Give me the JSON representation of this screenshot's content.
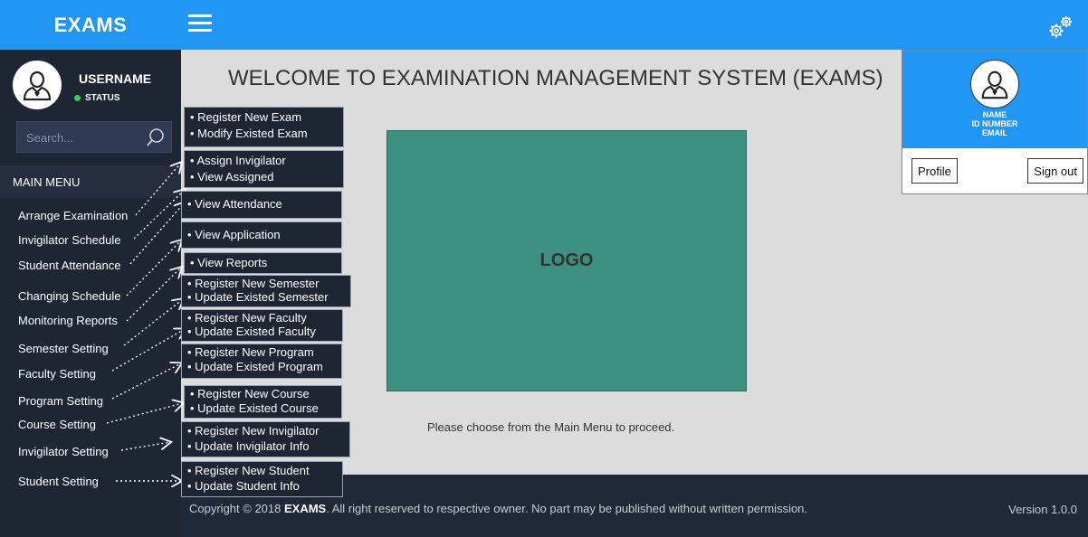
{
  "header": {
    "brand": "EXAMS"
  },
  "user": {
    "username": "USERNAME",
    "status": "STATUS"
  },
  "search": {
    "placeholder": "Search..."
  },
  "sidebar": {
    "main_menu_label": "MAIN MENU",
    "items": [
      {
        "label": "Arrange Examination"
      },
      {
        "label": "Invigilator Schedule"
      },
      {
        "label": "Student Attendance"
      },
      {
        "label": "Changing Schedule"
      },
      {
        "label": "Monitoring Reports"
      },
      {
        "label": "Semester Setting"
      },
      {
        "label": "Faculty Setting"
      },
      {
        "label": "Program Setting"
      },
      {
        "label": "Course Setting"
      },
      {
        "label": "Invigilator Setting"
      },
      {
        "label": "Student Setting"
      }
    ]
  },
  "submenus": [
    {
      "options": [
        "Register New Exam",
        "Modify Existed Exam"
      ]
    },
    {
      "options": [
        "Assign Invigilator",
        "View Assigned"
      ]
    },
    {
      "options": [
        "View Attendance"
      ]
    },
    {
      "options": [
        "View Application"
      ]
    },
    {
      "options": [
        "View Reports"
      ]
    },
    {
      "options": [
        "Register New Semester",
        "Update Existed Semester"
      ]
    },
    {
      "options": [
        "Register New Faculty",
        "Update Existed Faculty"
      ]
    },
    {
      "options": [
        "Register New Program",
        "Update Existed Program"
      ]
    },
    {
      "options": [
        "Register New Course",
        "Update Existed Course"
      ]
    },
    {
      "options": [
        "Register New Invigilator",
        "Update Invigilator Info"
      ]
    },
    {
      "options": [
        "Register New Student",
        "Update Student Info"
      ]
    }
  ],
  "main": {
    "welcome": "WELCOME TO EXAMINATION MANAGEMENT SYSTEM (EXAMS)",
    "logo": "LOGO",
    "prompt": "Please choose from the Main Menu to proceed."
  },
  "profile": {
    "name": "NAME",
    "id_number": "ID NUMBER",
    "email": "EMAIL",
    "profile_button": "Profile",
    "signout_button": "Sign out"
  },
  "footer": {
    "copy_prefix": "Copyright © 2018 ",
    "brand": "EXAMS",
    "copy_suffix": ". All right reserved to respective owner. No part may be published without written permission.",
    "version": "Version 1.0.0"
  },
  "colors": {
    "accent": "#2196f3",
    "sidebar": "#1e2533",
    "logo_box": "#3d8f7f",
    "status": "#34d058"
  }
}
